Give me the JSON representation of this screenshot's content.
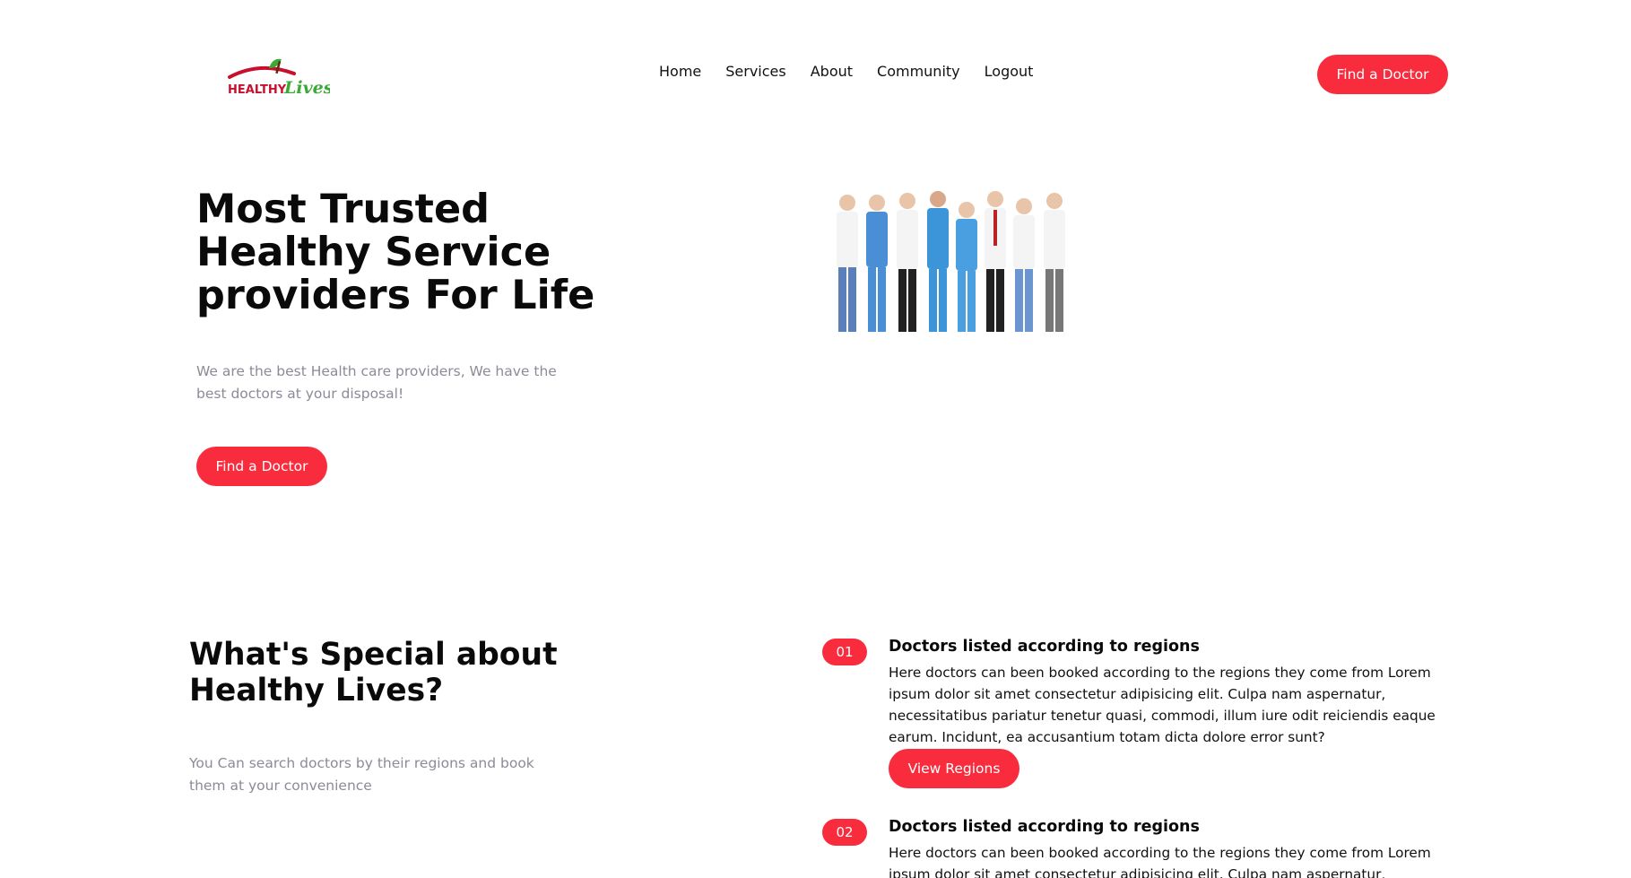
{
  "header": {
    "logo": {
      "word1": "HEALTHY",
      "word2": "Lives"
    },
    "nav": [
      "Home",
      "Services",
      "About",
      "Community",
      "Logout"
    ],
    "cta_label": "Find a Doctor"
  },
  "hero": {
    "title": "Most Trusted Healthy Service providers For Life",
    "subtitle": "We are the best Health care providers, We have the best doctors at your disposal!",
    "cta_label": "Find a Doctor"
  },
  "special": {
    "title": "What's Special about Healthy Lives?",
    "subtitle": "You Can search doctors by their regions and book them at your convenience"
  },
  "features": [
    {
      "num": "01",
      "title": "Doctors listed according to regions",
      "description": "Here doctors can been booked according to the regions they come from Lorem ipsum dolor sit amet consectetur adipisicing elit. Culpa nam aspernatur, necessitatibus pariatur tenetur quasi, commodi, illum iure odit reiciendis eaque earum. Incidunt, ea accusantium totam dicta dolore error sunt?",
      "button_label": "View Regions"
    },
    {
      "num": "02",
      "title": "Doctors listed according to regions",
      "description": "Here doctors can been booked according to the regions they come from Lorem ipsum dolor sit amet consectetur adipisicing elit. Culpa nam aspernatur, necessitatibus"
    }
  ],
  "colors": {
    "accent": "#f92c3d",
    "muted_text": "#8b8b99"
  }
}
